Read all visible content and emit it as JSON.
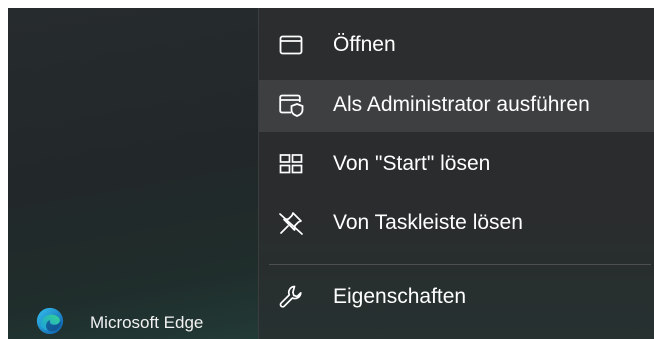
{
  "start_menu": {
    "app": {
      "label": "Microsoft Edge",
      "icon": "edge-icon"
    }
  },
  "context_menu": {
    "items": [
      {
        "label": "Öffnen",
        "icon": "window-icon"
      },
      {
        "label": "Als Administrator ausführen",
        "icon": "shield-window-icon",
        "highlighted": true
      },
      {
        "label": "Von \"Start\" lösen",
        "icon": "tiles-icon"
      },
      {
        "label": "Von Taskleiste lösen",
        "icon": "unpin-icon"
      },
      {
        "label": "Eigenschaften",
        "icon": "wrench-icon"
      }
    ]
  },
  "colors": {
    "highlight": "#3d3f41",
    "text": "#ffffff",
    "separator": "#4d4f50"
  }
}
